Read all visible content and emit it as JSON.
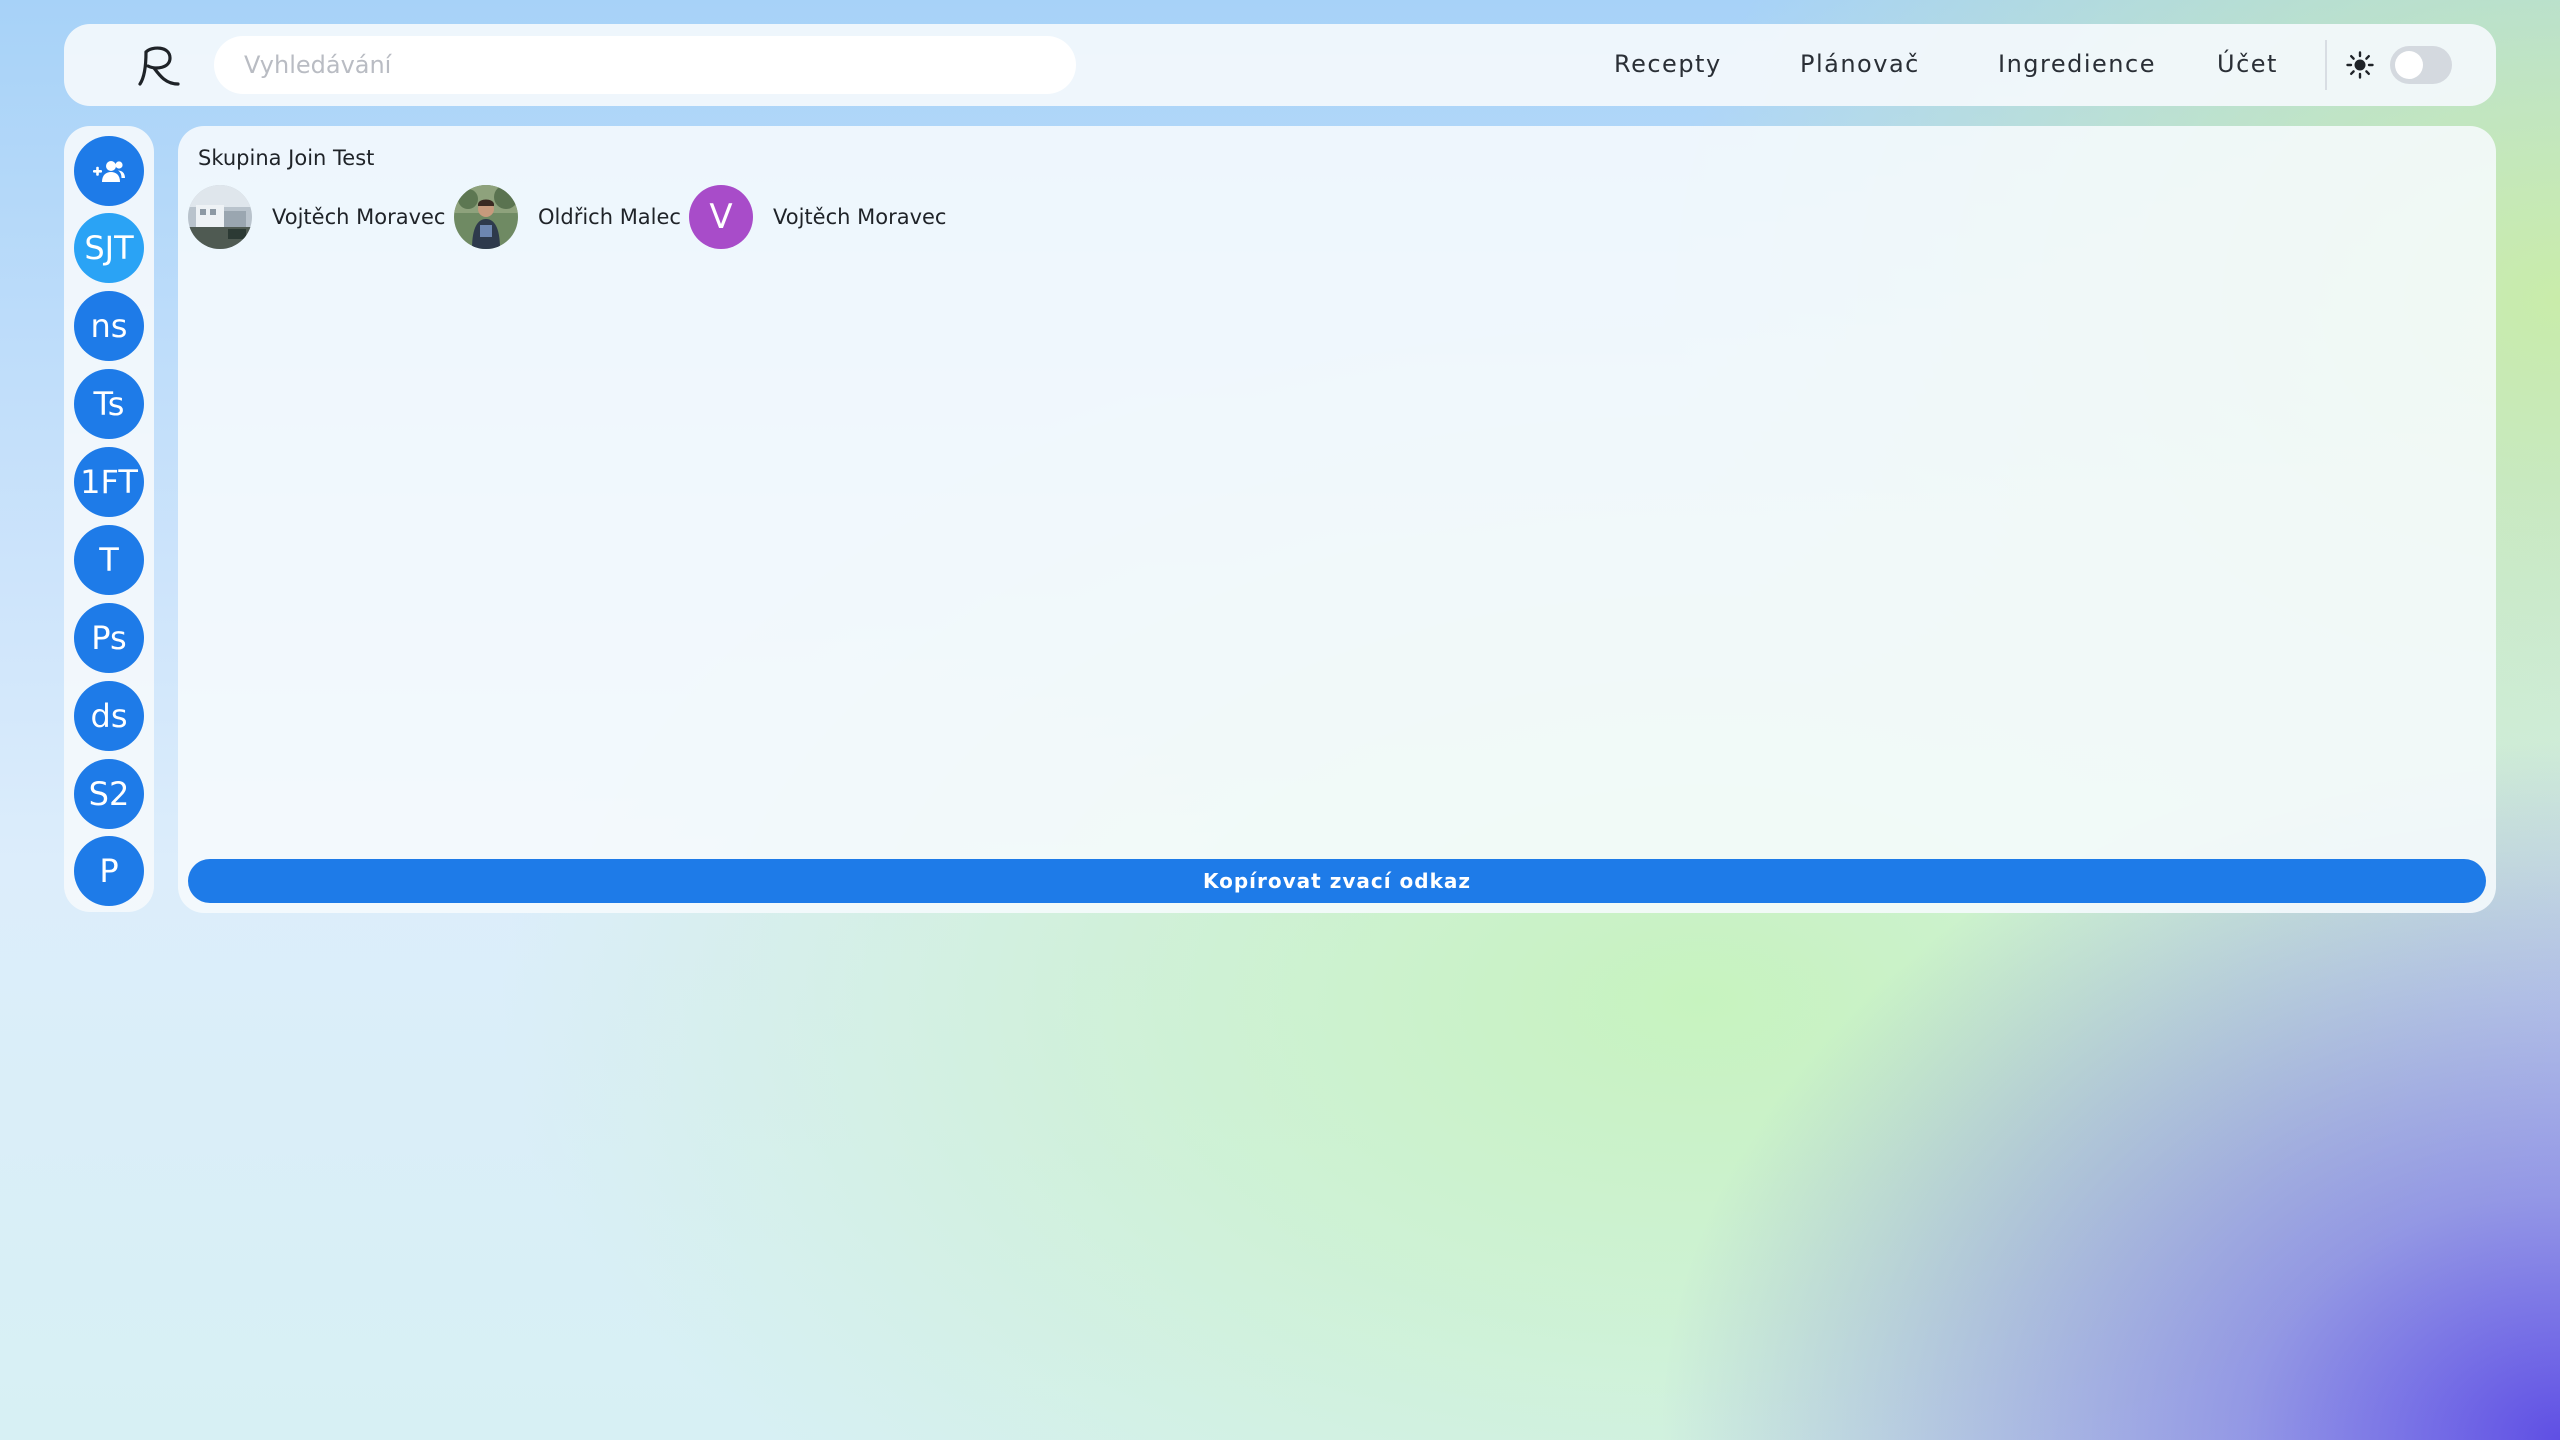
{
  "nav": {
    "search_placeholder": "Vyhledávání",
    "links": [
      "Recepty",
      "Plánovač",
      "Ingredience",
      "Účet"
    ],
    "theme_toggle_on": false
  },
  "sidebar": {
    "add_group_icon": "group-add-icon",
    "groups": [
      "SJT",
      "ns",
      "Ts",
      "1FT",
      "T",
      "Ps",
      "ds",
      "S2",
      "P"
    ],
    "active_index": 0
  },
  "group": {
    "title": "Skupina Join Test",
    "members": [
      {
        "name": "Vojtěch Moravec",
        "avatar": "photo"
      },
      {
        "name": "Oldřich Malec",
        "avatar": "photo"
      },
      {
        "name": "Vojtěch Moravec",
        "avatar": "letter",
        "initial": "V"
      }
    ],
    "copy_invite_label": "Kopírovat zvací odkaz"
  },
  "colors": {
    "primary": "#1e7be8",
    "active_group": "#2aa3f5",
    "letter_avatar": "#a84cc9"
  }
}
